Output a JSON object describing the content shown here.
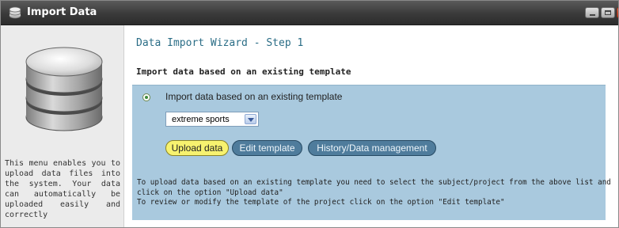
{
  "window": {
    "title": "Import Data"
  },
  "sidebar": {
    "description": "This menu enables you to upload data files into the system. Your data can automatically be uploaded easily and correctly"
  },
  "main": {
    "wizard_title": "Data Import Wizard - Step 1",
    "section_title": "Import data based on an existing template",
    "option": {
      "label": "Import data based on an existing template",
      "selected": true
    },
    "template_select": {
      "value": "extreme sports"
    },
    "buttons": {
      "upload": "Upload data",
      "edit": "Edit template",
      "history": "History/Data management"
    },
    "help_lines": [
      "To upload data based on an existing template you need to select the subject/project from the above list and",
      "click on the option \"Upload data\"",
      "To review or modify the template of the project click on the option \"Edit template\""
    ]
  },
  "colors": {
    "titlebar": "#3a3a3a",
    "panel": "#a9c9de",
    "upload_button": "#f7f26f",
    "secondary_button": "#4f7c9c",
    "title_text": "#2a6d86"
  },
  "icons": [
    "database-icon",
    "minimize-icon",
    "maximize-icon",
    "close-icon",
    "chevron-down-icon"
  ]
}
